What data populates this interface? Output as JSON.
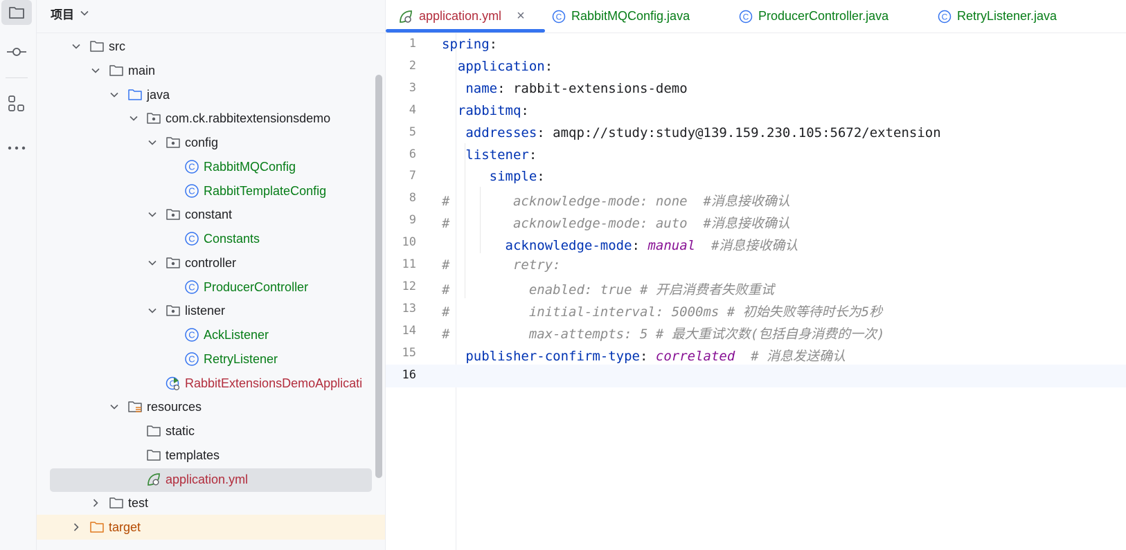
{
  "activity_bar": {
    "icons": [
      "project-folder-icon",
      "commit-icon",
      "structure-icon",
      "more-icon"
    ]
  },
  "project_panel": {
    "title": "项目",
    "tree": [
      {
        "label": "src",
        "kind": "folder",
        "expanded": true
      },
      {
        "label": "main",
        "kind": "folder",
        "expanded": true
      },
      {
        "label": "java",
        "kind": "source-folder",
        "expanded": true
      },
      {
        "label": "com.ck.rabbitextensionsdemo",
        "kind": "package",
        "expanded": true
      },
      {
        "label": "config",
        "kind": "package",
        "expanded": true
      },
      {
        "label": "RabbitMQConfig",
        "kind": "class"
      },
      {
        "label": "RabbitTemplateConfig",
        "kind": "class"
      },
      {
        "label": "constant",
        "kind": "package",
        "expanded": true
      },
      {
        "label": "Constants",
        "kind": "class"
      },
      {
        "label": "controller",
        "kind": "package",
        "expanded": true
      },
      {
        "label": "ProducerController",
        "kind": "class"
      },
      {
        "label": "listener",
        "kind": "package",
        "expanded": true
      },
      {
        "label": "AckListener",
        "kind": "class"
      },
      {
        "label": "RetryListener",
        "kind": "class"
      },
      {
        "label": "RabbitExtensionsDemoApplicati",
        "kind": "spring-app"
      },
      {
        "label": "resources",
        "kind": "resources-folder",
        "expanded": true
      },
      {
        "label": "static",
        "kind": "folder"
      },
      {
        "label": "templates",
        "kind": "folder"
      },
      {
        "label": "application.yml",
        "kind": "yml",
        "selected": true
      },
      {
        "label": "test",
        "kind": "folder",
        "expanded": false
      },
      {
        "label": "target",
        "kind": "excluded-folder",
        "expanded": false
      }
    ]
  },
  "tabs": [
    {
      "label": "application.yml",
      "active": true,
      "icon": "spring-yml-icon",
      "close": "×"
    },
    {
      "label": "RabbitMQConfig.java",
      "icon": "class-icon"
    },
    {
      "label": "ProducerController.java",
      "icon": "class-icon"
    },
    {
      "label": "RetryListener.java",
      "icon": "class-icon"
    }
  ],
  "editor": {
    "current_line": 16,
    "lines": [
      {
        "n": "1",
        "parts": [
          {
            "t": "spring",
            "c": "k"
          },
          {
            "t": ":",
            "c": "p"
          }
        ]
      },
      {
        "n": "2",
        "parts": [
          {
            "t": "  ",
            "c": "p"
          },
          {
            "t": "application",
            "c": "k"
          },
          {
            "t": ":",
            "c": "p"
          }
        ]
      },
      {
        "n": "3",
        "parts": [
          {
            "t": "   ",
            "c": "p"
          },
          {
            "t": "name",
            "c": "k"
          },
          {
            "t": ": ",
            "c": "p"
          },
          {
            "t": "rabbit-extensions-demo",
            "c": "v"
          }
        ]
      },
      {
        "n": "4",
        "parts": [
          {
            "t": "  ",
            "c": "p"
          },
          {
            "t": "rabbitmq",
            "c": "k"
          },
          {
            "t": ":",
            "c": "p"
          }
        ]
      },
      {
        "n": "5",
        "parts": [
          {
            "t": "   ",
            "c": "p"
          },
          {
            "t": "addresses",
            "c": "k"
          },
          {
            "t": ": ",
            "c": "p"
          },
          {
            "t": "amqp://study:study@139.159.230.105:5672/extension",
            "c": "v"
          }
        ]
      },
      {
        "n": "6",
        "parts": [
          {
            "t": "   ",
            "c": "p"
          },
          {
            "t": "listener",
            "c": "k"
          },
          {
            "t": ":",
            "c": "p"
          }
        ]
      },
      {
        "n": "7",
        "parts": [
          {
            "t": "      ",
            "c": "p"
          },
          {
            "t": "simple",
            "c": "k"
          },
          {
            "t": ":",
            "c": "p"
          }
        ]
      },
      {
        "n": "8",
        "parts": [
          {
            "t": "#        acknowledge-mode: none  #消息接收确认",
            "c": "c"
          }
        ]
      },
      {
        "n": "9",
        "parts": [
          {
            "t": "#        acknowledge-mode: auto  #消息接收确认",
            "c": "c"
          }
        ]
      },
      {
        "n": "10",
        "parts": [
          {
            "t": "        ",
            "c": "p"
          },
          {
            "t": "acknowledge-mode",
            "c": "k"
          },
          {
            "t": ": ",
            "c": "p"
          },
          {
            "t": "manual",
            "c": "e"
          },
          {
            "t": "  #消息接收确认",
            "c": "c"
          }
        ]
      },
      {
        "n": "11",
        "parts": [
          {
            "t": "#        retry:",
            "c": "c"
          }
        ]
      },
      {
        "n": "12",
        "parts": [
          {
            "t": "#          enabled: true # 开启消费者失败重试",
            "c": "c"
          }
        ]
      },
      {
        "n": "13",
        "parts": [
          {
            "t": "#          initial-interval: 5000ms # 初始失败等待时长为5秒",
            "c": "c"
          }
        ]
      },
      {
        "n": "14",
        "parts": [
          {
            "t": "#          max-attempts: 5 # 最大重试次数(包括自身消费的一次)",
            "c": "c"
          }
        ]
      },
      {
        "n": "15",
        "parts": [
          {
            "t": "   ",
            "c": "p"
          },
          {
            "t": "publisher-confirm-type",
            "c": "k"
          },
          {
            "t": ": ",
            "c": "p"
          },
          {
            "t": "correlated",
            "c": "e"
          },
          {
            "t": "  # 消息发送确认",
            "c": "c"
          }
        ]
      },
      {
        "n": "16",
        "parts": []
      }
    ]
  },
  "colors": {
    "accent": "#3574f0",
    "class_green": "#067d17",
    "modified_red": "#b22c3c",
    "yaml_key": "#0033b3",
    "enum_purple": "#871094",
    "comment_gray": "#8c8c8c"
  }
}
